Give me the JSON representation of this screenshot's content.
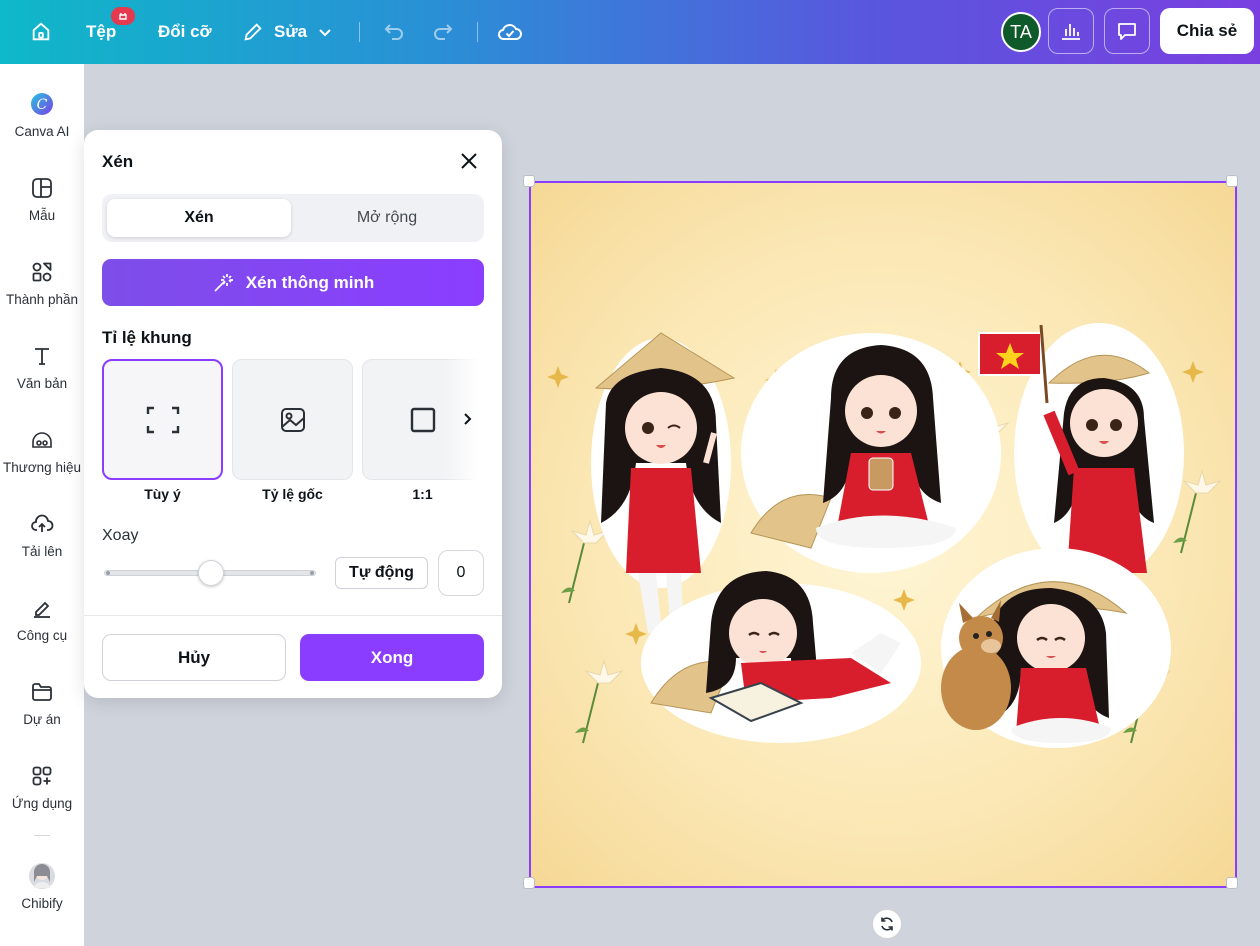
{
  "topbar": {
    "file_label": "Tệp",
    "resize_label": "Đổi cỡ",
    "edit_label": "Sửa",
    "avatar_initials": "TA",
    "share_label": "Chia sẻ"
  },
  "sidebar": {
    "items": [
      {
        "label": "Canva AI",
        "icon": "canva-ai-icon"
      },
      {
        "label": "Mẫu",
        "icon": "templates-icon"
      },
      {
        "label": "Thành phần",
        "icon": "elements-icon"
      },
      {
        "label": "Văn bản",
        "icon": "text-icon"
      },
      {
        "label": "Thương hiệu",
        "icon": "brand-icon"
      },
      {
        "label": "Tải lên",
        "icon": "upload-icon"
      },
      {
        "label": "Công cụ",
        "icon": "tools-icon"
      },
      {
        "label": "Dự án",
        "icon": "folder-icon"
      },
      {
        "label": "Ứng dụng",
        "icon": "apps-icon"
      },
      {
        "label": "Chibify",
        "icon": "chibify-avatar"
      }
    ]
  },
  "crop_panel": {
    "title": "Xén",
    "tabs": [
      {
        "label": "Xén",
        "active": true
      },
      {
        "label": "Mở rộng",
        "active": false
      }
    ],
    "smart_crop_label": "Xén thông minh",
    "ratio_title": "Tỉ lệ khung",
    "ratios": [
      {
        "label": "Tùy ý",
        "icon": "freeform-crop-icon",
        "selected": true
      },
      {
        "label": "Tỷ lệ gốc",
        "icon": "image-icon",
        "selected": false
      },
      {
        "label": "1:1",
        "icon": "square-icon",
        "selected": false
      }
    ],
    "rotate_title": "Xoay",
    "rotate_value": "0",
    "rotate_slider_fraction": 0.5,
    "auto_label": "Tự động",
    "cancel_label": "Hủy",
    "done_label": "Xong"
  },
  "colors": {
    "accent": "#8b3dff",
    "ao_dai_red": "#d81e2c"
  }
}
